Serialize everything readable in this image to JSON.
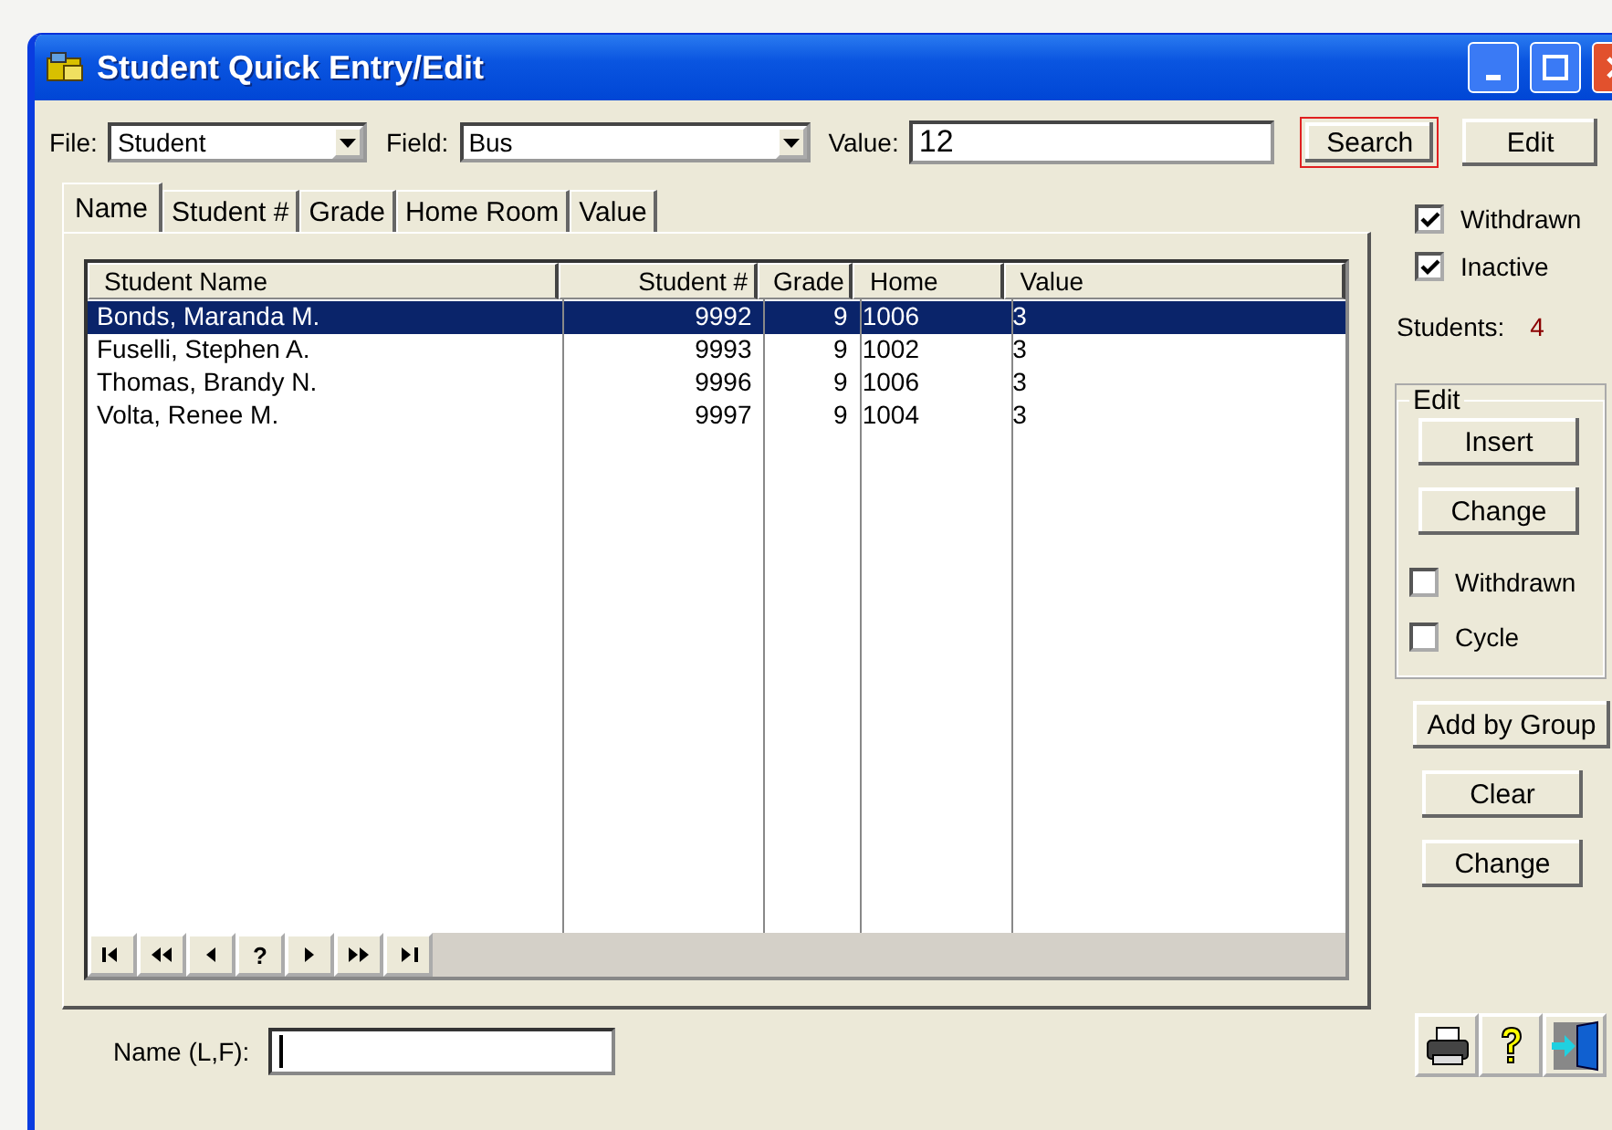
{
  "window": {
    "title": "Student Quick Entry/Edit"
  },
  "toolbar": {
    "file_label": "File:",
    "file_value": "Student",
    "field_label": "Field:",
    "field_value": "Bus",
    "value_label": "Value:",
    "value": "12",
    "buttons": [
      {
        "label": "Search",
        "focused": true
      },
      {
        "label": "Edit",
        "focused": false
      }
    ]
  },
  "tabs": [
    {
      "label": "Name",
      "selected": true
    },
    {
      "label": "Student #",
      "selected": false
    },
    {
      "label": "Grade",
      "selected": false
    },
    {
      "label": "Home Room",
      "selected": false
    },
    {
      "label": "Value",
      "selected": false
    }
  ],
  "table": {
    "columns": [
      {
        "label": "Student Name"
      },
      {
        "label": "Student #"
      },
      {
        "label": "Grade"
      },
      {
        "label": "Home"
      },
      {
        "label": "Value"
      }
    ],
    "rows": [
      {
        "cells": [
          "Bonds, Maranda M.",
          "9992",
          "9",
          "1006",
          "3"
        ],
        "selected": true
      },
      {
        "cells": [
          "Fuselli, Stephen A.",
          "9993",
          "9",
          "1002",
          "3"
        ],
        "selected": false
      },
      {
        "cells": [
          "Thomas, Brandy N.",
          "9996",
          "9",
          "1006",
          "3"
        ],
        "selected": false
      },
      {
        "cells": [
          "Volta, Renee M.",
          "9997",
          "9",
          "1004",
          "3"
        ],
        "selected": false
      }
    ]
  },
  "nav": [
    {
      "kind": "first"
    },
    {
      "kind": "prev_page"
    },
    {
      "kind": "prev"
    },
    {
      "kind": "find",
      "label": "?"
    },
    {
      "kind": "next"
    },
    {
      "kind": "next_page"
    },
    {
      "kind": "last"
    }
  ],
  "name_field": {
    "label": "Name (L,F):"
  },
  "filters": [
    {
      "label": "Withdrawn",
      "checked": true
    },
    {
      "label": "Inactive",
      "checked": true
    }
  ],
  "count": {
    "label": "Students:",
    "value": "4"
  },
  "edit_group": {
    "title": "Edit",
    "buttons": [
      "Insert",
      "Change"
    ],
    "options": [
      {
        "label": "Withdrawn",
        "checked": false
      },
      {
        "label": "Cycle",
        "checked": false
      }
    ]
  },
  "buttons": [
    "Add by Group",
    "Clear",
    "Change"
  ],
  "footer_icons": [
    {
      "kind": "print"
    },
    {
      "kind": "help"
    },
    {
      "kind": "exit"
    }
  ]
}
